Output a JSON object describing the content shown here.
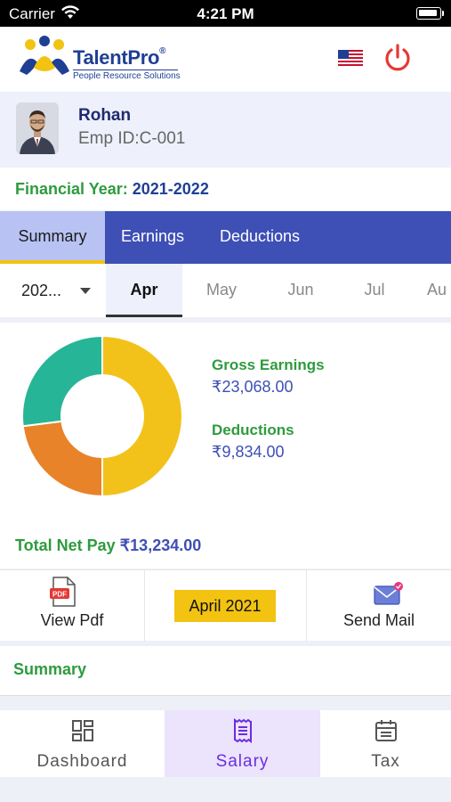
{
  "status_bar": {
    "carrier": "Carrier",
    "time": "4:21 PM"
  },
  "header": {
    "logo_brand": "TalentPro",
    "logo_reg": "®",
    "logo_tagline": "People Resource Solutions",
    "language_icon": "us-flag-icon",
    "power_icon": "power-icon"
  },
  "profile": {
    "name": "Rohan",
    "emp_id": "Emp ID:C-001"
  },
  "financial_year": {
    "label": "Financial Year:",
    "value": "2021-2022"
  },
  "tabs": [
    {
      "label": "Summary",
      "active": true
    },
    {
      "label": "Earnings",
      "active": false
    },
    {
      "label": "Deductions",
      "active": false
    }
  ],
  "year_select": {
    "value": "202..."
  },
  "months": [
    {
      "label": "Apr",
      "active": true
    },
    {
      "label": "May",
      "active": false
    },
    {
      "label": "Jun",
      "active": false
    },
    {
      "label": "Jul",
      "active": false
    },
    {
      "label": "Au",
      "active": false
    }
  ],
  "chart_data": {
    "type": "pie",
    "donut": true,
    "slices": [
      {
        "color": "#f2c21b",
        "value": 50
      },
      {
        "color": "#e8832a",
        "value": 23
      },
      {
        "color": "#27b597",
        "value": 27
      }
    ]
  },
  "legend": {
    "gross_label": "Gross Earnings",
    "gross_value": "₹23,068.00",
    "deductions_label": "Deductions",
    "deductions_value": "₹9,834.00"
  },
  "net_pay": {
    "label": "Total Net Pay",
    "value": "₹13,234.00"
  },
  "actions": {
    "view_pdf": "View Pdf",
    "month_badge": "April 2021",
    "send_mail": "Send Mail"
  },
  "summary_heading": "Summary",
  "bottom_nav": [
    {
      "label": "Dashboard",
      "icon": "dashboard-icon",
      "active": false
    },
    {
      "label": "Salary",
      "icon": "salary-icon",
      "active": true
    },
    {
      "label": "Tax",
      "icon": "tax-icon",
      "active": false
    }
  ],
  "colors": {
    "primary": "#3e4fb5",
    "green": "#2e9b3e",
    "yellow": "#f3c312",
    "nav_active": "#6a2de0"
  }
}
